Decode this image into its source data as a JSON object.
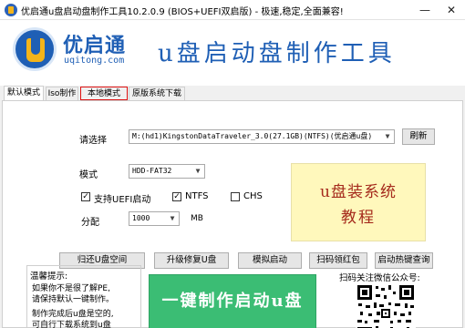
{
  "window": {
    "title": "优启通u盘启动盘制作工具10.2.0.9  (BIOS+UEFI双启版)  - 极速,稳定,全面兼容!",
    "minimize_glyph": "—",
    "close_glyph": "✕"
  },
  "header": {
    "logo_name": "优启通",
    "logo_site": "uqitong.com",
    "slogan": "u盘启动盘制作工具"
  },
  "tabs": [
    {
      "label": "默认模式",
      "active": true
    },
    {
      "label": "Iso制作",
      "active": false
    },
    {
      "label": "本地模式",
      "active": false,
      "highlighted": true
    },
    {
      "label": "原版系统下载",
      "active": false
    }
  ],
  "form": {
    "device_label": "请选择",
    "device_value": "M:(hd1)KingstonDataTraveler_3.0(27.1GB)(NTFS)(优启通u盘)",
    "refresh_label": "刷新",
    "mode_label": "模式",
    "mode_value": "HDD-FAT32",
    "uefi_label": "支持UEFI启动",
    "uefi_checked": true,
    "ntfs_label": "NTFS",
    "ntfs_checked": true,
    "chs_label": "CHS",
    "chs_checked": false,
    "partition_label": "分配",
    "partition_value": "1000",
    "partition_unit": "MB",
    "caret": "▼",
    "check_glyph": "✓"
  },
  "ad": {
    "line1": "u盘装系统",
    "line2": "教程"
  },
  "actions": [
    {
      "label": "归还U盘空间"
    },
    {
      "label": "升级修复U盘"
    },
    {
      "label": "模拟启动"
    },
    {
      "label": "扫码领红包"
    },
    {
      "label": "启动热键查询"
    }
  ],
  "tips": {
    "title": "温馨提示:",
    "lines": [
      "如果你不是很了解PE,",
      "请保持默认一键制作。",
      "制作完成后u盘是空的,",
      "可自行下载系统到u盘"
    ]
  },
  "main_button": "一键制作启动u盘",
  "qr": {
    "label": "扫码关注微信公众号:"
  }
}
